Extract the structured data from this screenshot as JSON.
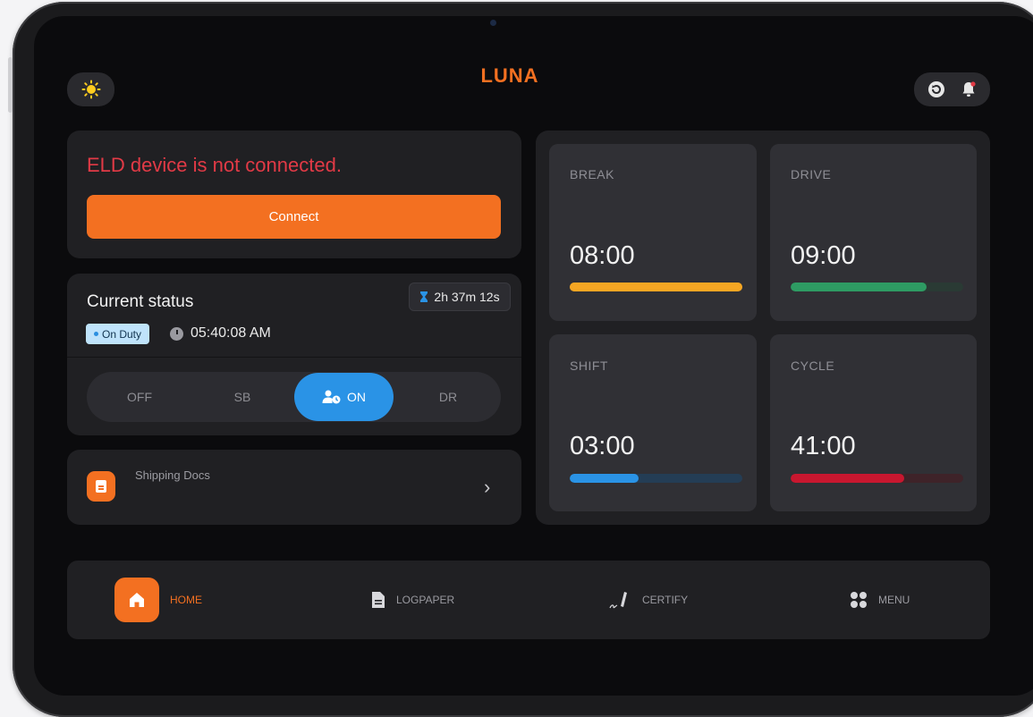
{
  "header": {
    "logo_text": "LUNA",
    "theme_icon": "sun-icon",
    "right_icons": [
      "refresh-icon",
      "bell-icon"
    ]
  },
  "eld": {
    "message": "ELD device is not connected.",
    "connect_label": "Connect"
  },
  "status": {
    "title": "Current status",
    "timer": "2h 37m 12s",
    "duty_badge": "On Duty",
    "time": "05:40:08 AM",
    "segments": [
      "OFF",
      "SB",
      "ON",
      "DR"
    ],
    "active_segment": "ON"
  },
  "docs": {
    "label": "Shipping Docs"
  },
  "timers": [
    {
      "label": "BREAK",
      "value": "08:00",
      "progress": 1.0,
      "color": "#f5a623",
      "track": "#f5a623"
    },
    {
      "label": "DRIVE",
      "value": "09:00",
      "progress": 0.79,
      "color": "#2e9b63",
      "track": "#2a3a34"
    },
    {
      "label": "SHIFT",
      "value": "03:00",
      "progress": 0.4,
      "color": "#2a93e6",
      "track": "#243d55"
    },
    {
      "label": "CYCLE",
      "value": "41:00",
      "progress": 0.66,
      "color": "#c8172f",
      "track": "#3e2329"
    }
  ],
  "nav": {
    "home": "HOME",
    "logpaper": "LOGPAPER",
    "certify": "CERTIFY",
    "menu": "MENU",
    "active": "HOME"
  },
  "colors": {
    "accent": "#f37021",
    "error": "#e23a46",
    "active_blue": "#2a93e6"
  }
}
